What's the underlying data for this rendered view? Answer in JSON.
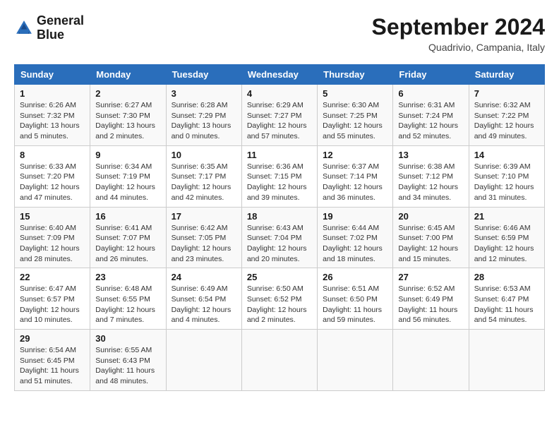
{
  "logo": {
    "line1": "General",
    "line2": "Blue"
  },
  "title": "September 2024",
  "subtitle": "Quadrivio, Campania, Italy",
  "days_of_week": [
    "Sunday",
    "Monday",
    "Tuesday",
    "Wednesday",
    "Thursday",
    "Friday",
    "Saturday"
  ],
  "weeks": [
    [
      {
        "day": 1,
        "info": "Sunrise: 6:26 AM\nSunset: 7:32 PM\nDaylight: 13 hours\nand 5 minutes."
      },
      {
        "day": 2,
        "info": "Sunrise: 6:27 AM\nSunset: 7:30 PM\nDaylight: 13 hours\nand 2 minutes."
      },
      {
        "day": 3,
        "info": "Sunrise: 6:28 AM\nSunset: 7:29 PM\nDaylight: 13 hours\nand 0 minutes."
      },
      {
        "day": 4,
        "info": "Sunrise: 6:29 AM\nSunset: 7:27 PM\nDaylight: 12 hours\nand 57 minutes."
      },
      {
        "day": 5,
        "info": "Sunrise: 6:30 AM\nSunset: 7:25 PM\nDaylight: 12 hours\nand 55 minutes."
      },
      {
        "day": 6,
        "info": "Sunrise: 6:31 AM\nSunset: 7:24 PM\nDaylight: 12 hours\nand 52 minutes."
      },
      {
        "day": 7,
        "info": "Sunrise: 6:32 AM\nSunset: 7:22 PM\nDaylight: 12 hours\nand 49 minutes."
      }
    ],
    [
      {
        "day": 8,
        "info": "Sunrise: 6:33 AM\nSunset: 7:20 PM\nDaylight: 12 hours\nand 47 minutes."
      },
      {
        "day": 9,
        "info": "Sunrise: 6:34 AM\nSunset: 7:19 PM\nDaylight: 12 hours\nand 44 minutes."
      },
      {
        "day": 10,
        "info": "Sunrise: 6:35 AM\nSunset: 7:17 PM\nDaylight: 12 hours\nand 42 minutes."
      },
      {
        "day": 11,
        "info": "Sunrise: 6:36 AM\nSunset: 7:15 PM\nDaylight: 12 hours\nand 39 minutes."
      },
      {
        "day": 12,
        "info": "Sunrise: 6:37 AM\nSunset: 7:14 PM\nDaylight: 12 hours\nand 36 minutes."
      },
      {
        "day": 13,
        "info": "Sunrise: 6:38 AM\nSunset: 7:12 PM\nDaylight: 12 hours\nand 34 minutes."
      },
      {
        "day": 14,
        "info": "Sunrise: 6:39 AM\nSunset: 7:10 PM\nDaylight: 12 hours\nand 31 minutes."
      }
    ],
    [
      {
        "day": 15,
        "info": "Sunrise: 6:40 AM\nSunset: 7:09 PM\nDaylight: 12 hours\nand 28 minutes."
      },
      {
        "day": 16,
        "info": "Sunrise: 6:41 AM\nSunset: 7:07 PM\nDaylight: 12 hours\nand 26 minutes."
      },
      {
        "day": 17,
        "info": "Sunrise: 6:42 AM\nSunset: 7:05 PM\nDaylight: 12 hours\nand 23 minutes."
      },
      {
        "day": 18,
        "info": "Sunrise: 6:43 AM\nSunset: 7:04 PM\nDaylight: 12 hours\nand 20 minutes."
      },
      {
        "day": 19,
        "info": "Sunrise: 6:44 AM\nSunset: 7:02 PM\nDaylight: 12 hours\nand 18 minutes."
      },
      {
        "day": 20,
        "info": "Sunrise: 6:45 AM\nSunset: 7:00 PM\nDaylight: 12 hours\nand 15 minutes."
      },
      {
        "day": 21,
        "info": "Sunrise: 6:46 AM\nSunset: 6:59 PM\nDaylight: 12 hours\nand 12 minutes."
      }
    ],
    [
      {
        "day": 22,
        "info": "Sunrise: 6:47 AM\nSunset: 6:57 PM\nDaylight: 12 hours\nand 10 minutes."
      },
      {
        "day": 23,
        "info": "Sunrise: 6:48 AM\nSunset: 6:55 PM\nDaylight: 12 hours\nand 7 minutes."
      },
      {
        "day": 24,
        "info": "Sunrise: 6:49 AM\nSunset: 6:54 PM\nDaylight: 12 hours\nand 4 minutes."
      },
      {
        "day": 25,
        "info": "Sunrise: 6:50 AM\nSunset: 6:52 PM\nDaylight: 12 hours\nand 2 minutes."
      },
      {
        "day": 26,
        "info": "Sunrise: 6:51 AM\nSunset: 6:50 PM\nDaylight: 11 hours\nand 59 minutes."
      },
      {
        "day": 27,
        "info": "Sunrise: 6:52 AM\nSunset: 6:49 PM\nDaylight: 11 hours\nand 56 minutes."
      },
      {
        "day": 28,
        "info": "Sunrise: 6:53 AM\nSunset: 6:47 PM\nDaylight: 11 hours\nand 54 minutes."
      }
    ],
    [
      {
        "day": 29,
        "info": "Sunrise: 6:54 AM\nSunset: 6:45 PM\nDaylight: 11 hours\nand 51 minutes."
      },
      {
        "day": 30,
        "info": "Sunrise: 6:55 AM\nSunset: 6:43 PM\nDaylight: 11 hours\nand 48 minutes."
      },
      null,
      null,
      null,
      null,
      null
    ]
  ]
}
